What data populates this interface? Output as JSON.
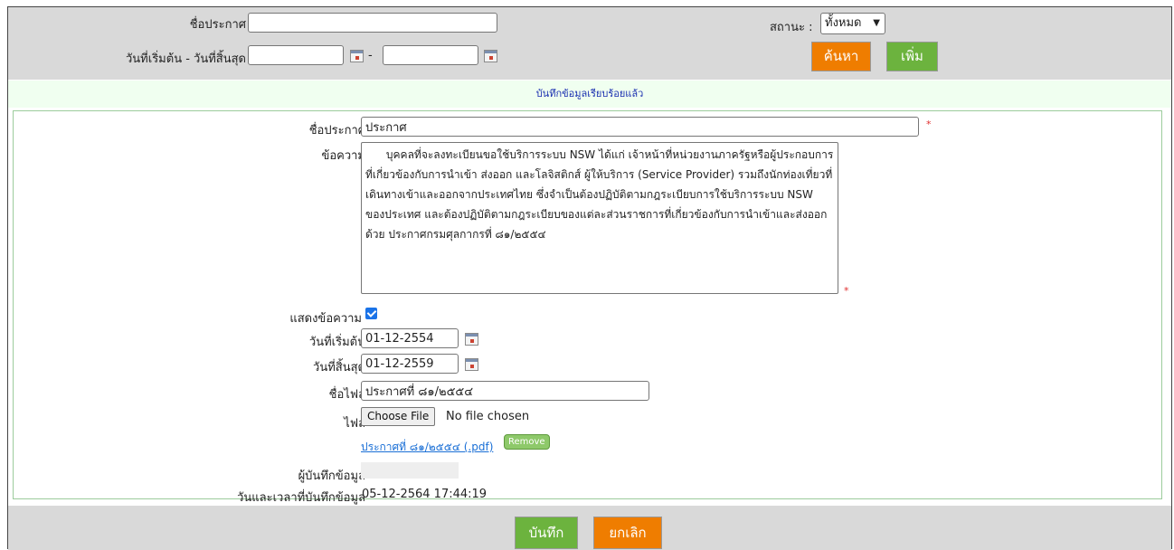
{
  "search": {
    "title_label": "ชื่อประกาศ",
    "title_value": "",
    "date_range_label": "วันที่เริ่มต้น - วันที่สิ้นสุด",
    "start_value": "",
    "end_value": "",
    "range_sep": "-",
    "status_label": "สถานะ",
    "status_selected": "ทั้งหมด",
    "search_button": "ค้นหา",
    "add_button": "เพิ่ม"
  },
  "notice": "บันทึกข้อมูลเรียบร้อยแล้ว",
  "form": {
    "title_label": "ชื่อประกาศ",
    "title_value": "ประกาศ",
    "message_label": "ข้อความ",
    "message_value": "      บุคคลที่จะลงทะเบียนขอใช้บริการระบบ NSW ได้แก่ เจ้าหน้าที่หน่วยงานภาครัฐหรือผู้ประกอบการ ที่เกี่ยวข้องกับการนำเข้า ส่งออก และโลจิสติกส์ ผู้ให้บริการ (Service Provider) รวมถึงนักท่องเที่ยวที่เดินทางเข้าและออกจากประเทศไทย ซึ่งจำเป็นต้องปฏิบัติตามกฎระเบียบการใช้บริการระบบ NSW ของประเทศ และต้องปฏิบัติตามกฎระเบียบของแต่ละส่วนราชการที่เกี่ยวข้องกับการนำเข้าและส่งออกด้วย ประกาศกรมศุลกากรที่ ๘๑/๒๕๕๔",
    "show_message_label": "แสดงข้อความ",
    "show_message_checked": true,
    "start_label": "วันที่เริ่มต้น",
    "start_value": "01-12-2554",
    "end_label": "วันที่สิ้นสุด",
    "end_value": "01-12-2559",
    "filename_label": "ชื่อไฟล์",
    "filename_value": "ประกาศที่ ๘๑/๒๕๕๔",
    "file_label": "ไฟล์",
    "choose_file": "Choose File",
    "no_file": "No file chosen",
    "attached_link": "ประกาศที่ ๘๑/๒๕๕๔ (.pdf)",
    "remove": "Remove",
    "recorder_label": "ผู้บันทึกข้อมูล",
    "recorder_value": "",
    "datetime_label": "วันและเวลาที่บันทึกข้อมูล",
    "datetime_value": "05-12-2564 17:44:19",
    "required_mark": "*"
  },
  "actions": {
    "save": "บันทึก",
    "cancel": "ยกเลิก"
  }
}
